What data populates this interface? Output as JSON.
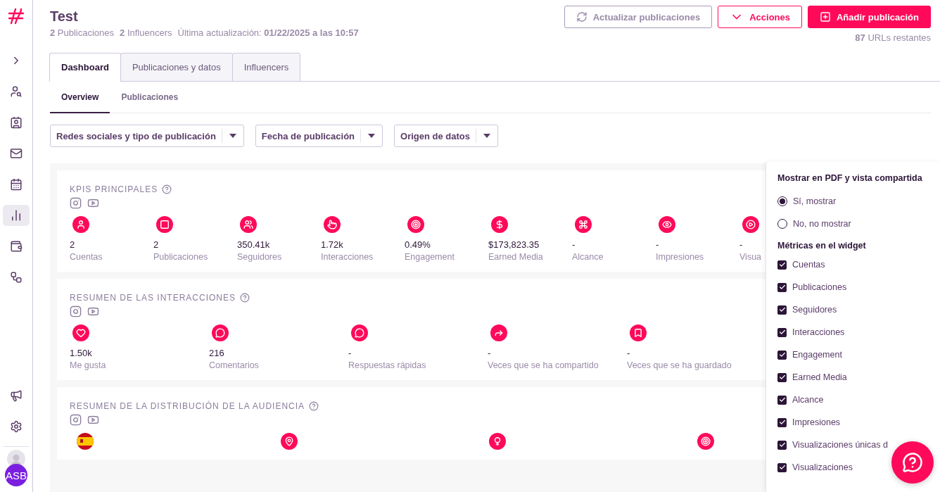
{
  "sidebar": {
    "top": [
      {
        "kind": "expand",
        "selected": false
      },
      {
        "kind": "search-user",
        "selected": false
      },
      {
        "kind": "contacts",
        "selected": false
      },
      {
        "kind": "mail",
        "selected": false
      },
      {
        "kind": "calendar",
        "selected": false
      },
      {
        "kind": "chart",
        "selected": true
      },
      {
        "kind": "wallet",
        "selected": false
      },
      {
        "kind": "network",
        "selected": false
      }
    ],
    "bottom": [
      {
        "kind": "megaphone"
      },
      {
        "kind": "settings"
      }
    ],
    "avatar_initials": "ASB"
  },
  "header": {
    "title": "Test",
    "stats": [
      "**2** Publicaciones",
      "**2** Influencers",
      "Última actualización: **01/22/2025 a las 10:57**"
    ],
    "buttons": [
      {
        "kind": "refresh",
        "label": "Actualizar publicaciones"
      },
      {
        "kind": "actions",
        "label": "Acciones"
      },
      {
        "kind": "add",
        "label": "Añadir publicación"
      }
    ],
    "remaining": {
      "value": "87",
      "label": "URLs restantes"
    }
  },
  "tabs": [
    {
      "label": "Dashboard",
      "selected": true
    },
    {
      "label": "Publicaciones y datos",
      "selected": false
    },
    {
      "label": "Influencers",
      "selected": false
    }
  ],
  "subtabs": [
    {
      "label": "Overview",
      "selected": true
    },
    {
      "label": "Publicaciones",
      "selected": false
    }
  ],
  "filters": [
    "Redes sociales y tipo de publicación",
    "Fecha de publicación",
    "Origen de datos"
  ],
  "widgets": [
    {
      "title": "KPIS PRINCIPALES",
      "metrics": [
        {
          "kind": "user",
          "value": "2",
          "label": "Cuentas"
        },
        {
          "kind": "square",
          "value": "2",
          "label": "Publicaciones"
        },
        {
          "kind": "users",
          "value": "350.41k",
          "label": "Seguidores"
        },
        {
          "kind": "pointer",
          "value": "1.72k",
          "label": "Interacciones"
        },
        {
          "kind": "target",
          "value": "0.49%",
          "label": "Engagement"
        },
        {
          "kind": "dollar",
          "value": "$173,823.35",
          "label": "Earned Media"
        },
        {
          "kind": "command",
          "value": "-",
          "label": "Alcance"
        },
        {
          "kind": "eye",
          "value": "-",
          "label": "Impresiones"
        },
        {
          "kind": "play",
          "value": "-",
          "label": "Visua"
        }
      ]
    },
    {
      "title": "RESUMEN DE LAS INTERACCIONES",
      "metrics": [
        {
          "kind": "heart",
          "value": "1.50k",
          "label": "Me gusta"
        },
        {
          "kind": "comment",
          "value": "216",
          "label": "Comentarios"
        },
        {
          "kind": "comment",
          "value": "-",
          "label": "Respuestas rápidas"
        },
        {
          "kind": "share",
          "value": "-",
          "label": "Veces que se ha compartido"
        },
        {
          "kind": "bookmark",
          "value": "-",
          "label": "Veces que se ha guardado"
        }
      ]
    },
    {
      "title": "RESUMEN DE LA DISTRIBUCIÓN DE LA AUDIENCIA",
      "metrics": [
        {
          "kind": "flag"
        },
        {
          "kind": "pin"
        },
        {
          "kind": "female"
        },
        {
          "kind": "target"
        }
      ]
    }
  ],
  "panel": {
    "show_title": "Mostrar en PDF y vista compartida",
    "options": [
      {
        "label": "Sí, mostrar",
        "selected": true
      },
      {
        "label": "No, no mostrar",
        "selected": false
      }
    ],
    "metrics_title": "Métricas en el widget",
    "metrics": [
      {
        "label": "Cuentas",
        "checked": true
      },
      {
        "label": "Publicaciones",
        "checked": true
      },
      {
        "label": "Seguidores",
        "checked": true
      },
      {
        "label": "Interacciones",
        "checked": true
      },
      {
        "label": "Engagement",
        "checked": true
      },
      {
        "label": "Earned Media",
        "checked": true
      },
      {
        "label": "Alcance",
        "checked": true
      },
      {
        "label": "Impresiones",
        "checked": true
      },
      {
        "label": "Visualizaciones únicas d",
        "checked": true
      },
      {
        "label": "Visualizaciones",
        "checked": true
      }
    ]
  }
}
